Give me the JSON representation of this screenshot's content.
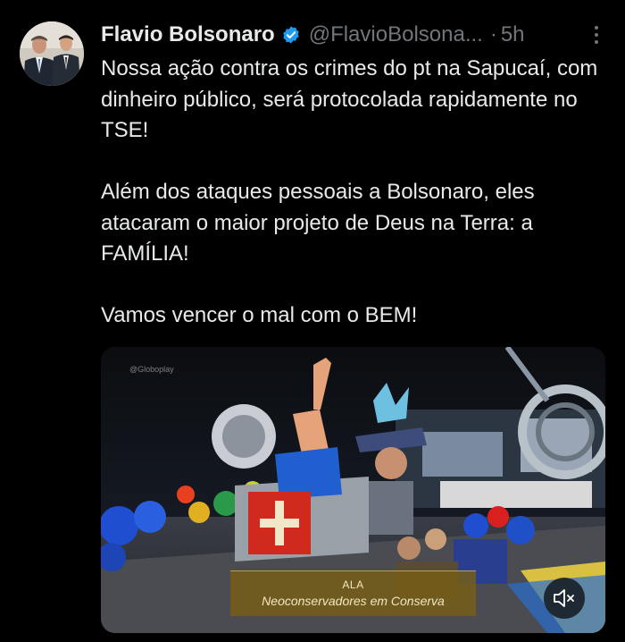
{
  "author": {
    "name": "Flavio Bolsonaro",
    "handle": "@FlavioBolsona...",
    "separator": "·",
    "time": "5h",
    "verified_color": "#1d9bf0"
  },
  "post": {
    "paragraphs": [
      "Nossa ação contra os crimes do pt na Sapucaí, com dinheiro público, será protocolada rapidamente no TSE!",
      "Além dos ataques pessoais a Bolsonaro, eles atacaram o maior projeto de Deus na Terra: a FAMÍLIA!",
      "Vamos vencer o mal com o BEM!"
    ]
  },
  "media": {
    "watermark": "@Globoplay",
    "caption_line1": "ALA",
    "caption_line2": "Neoconservadores em Conserva",
    "mute_icon": "volume-muted-icon"
  },
  "icons": {
    "more": "more-vertical-icon",
    "verified": "verified-badge-icon"
  }
}
